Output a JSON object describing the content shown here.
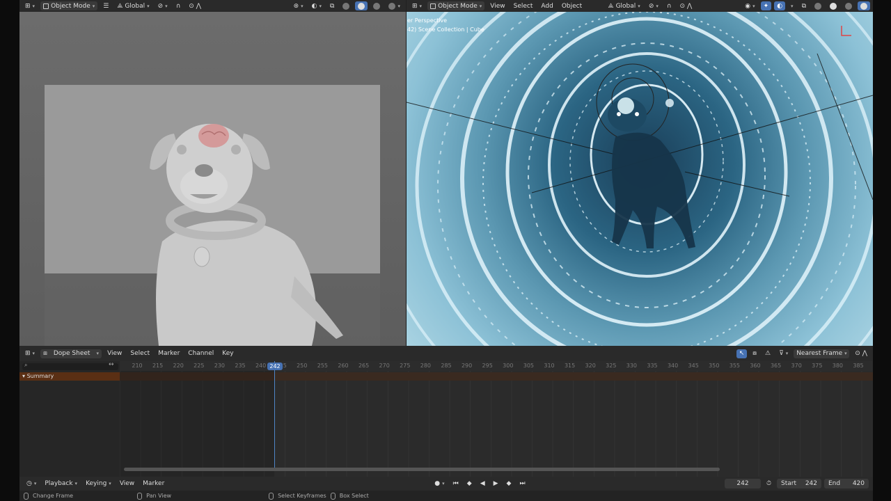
{
  "header_left": {
    "mode": "Object Mode",
    "orientation": "Global"
  },
  "header_right": {
    "mode": "Object Mode",
    "menus": [
      "View",
      "Select",
      "Add",
      "Object"
    ],
    "orientation": "Global"
  },
  "viewport_right": {
    "overlay_line1": "er Perspective",
    "overlay_line2": "42) Scene Collection | Cube"
  },
  "dopesheet": {
    "editor": "Dope Sheet",
    "menus": [
      "View",
      "Select",
      "Marker",
      "Channel",
      "Key"
    ],
    "snap": "Nearest Frame",
    "summary": "Summary",
    "ruler": [
      "210",
      "215",
      "220",
      "225",
      "230",
      "235",
      "240",
      "245",
      "250",
      "255",
      "260",
      "265",
      "270",
      "275",
      "280",
      "285",
      "290",
      "295",
      "300",
      "305",
      "310",
      "315",
      "320",
      "325",
      "330",
      "335",
      "340",
      "345",
      "350",
      "355",
      "360",
      "365",
      "370",
      "375",
      "380",
      "385"
    ],
    "current_frame": "242"
  },
  "timeline": {
    "playback": "Playback",
    "keying": "Keying",
    "view": "View",
    "marker": "Marker",
    "current": "242",
    "start_label": "Start",
    "start": "242",
    "end_label": "End",
    "end": "420"
  },
  "status": {
    "item1": "Change Frame",
    "item2": "Pan View",
    "item3": "Select Keyframes",
    "item4": "Box Select"
  }
}
